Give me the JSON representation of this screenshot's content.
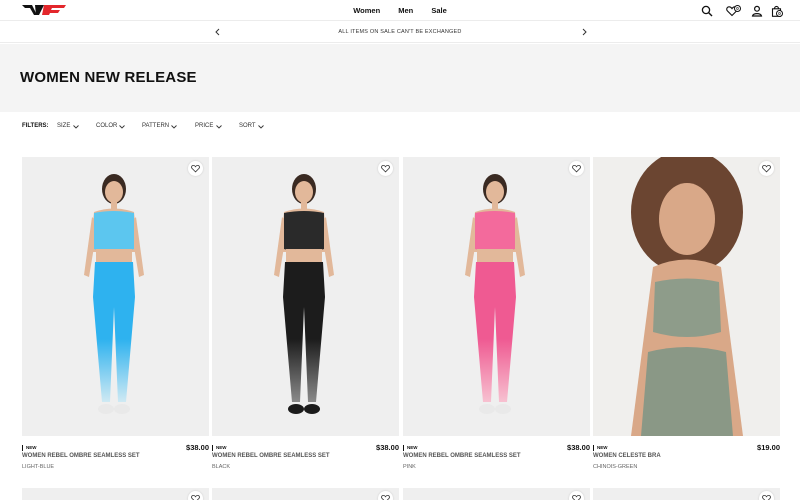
{
  "header": {
    "logo_alt": "VF",
    "nav": [
      "Women",
      "Men",
      "Sale"
    ],
    "icons": [
      "search-icon",
      "heart-icon",
      "user-icon",
      "bag-icon"
    ],
    "wishlist_count": "0",
    "cart_count": "0"
  },
  "announcement": {
    "text": "ALL ITEMS ON SALE CAN'T BE EXCHANGED"
  },
  "hero": {
    "title": "WOMEN NEW RELEASE"
  },
  "filters": {
    "label": "FILTERS:",
    "items": [
      "SIZE",
      "COLOR",
      "PATTERN",
      "PRICE",
      "SORT"
    ]
  },
  "products": [
    {
      "tag": "NEW",
      "name": "WOMEN REBEL OMBRE SEAMLESS SET",
      "price": "$38.00",
      "color": "LIGHT-BLUE",
      "top_color": "#5cc6ef",
      "bottom_color": "#2eb2ef",
      "fade_color": "#cfe9f3"
    },
    {
      "tag": "NEW",
      "name": "WOMEN REBEL OMBRE SEAMLESS SET",
      "price": "$38.00",
      "color": "BLACK",
      "top_color": "#2a2a2a",
      "bottom_color": "#1c1c1c",
      "fade_color": "#8a8a8a"
    },
    {
      "tag": "NEW",
      "name": "WOMEN REBEL OMBRE SEAMLESS SET",
      "price": "$38.00",
      "color": "PINK",
      "top_color": "#f36a9c",
      "bottom_color": "#ef5a92",
      "fade_color": "#f7c1d0"
    },
    {
      "tag": "NEW",
      "name": "WOMEN CELESTE BRA",
      "price": "$19.00",
      "color": "CHINOIS-GREEN",
      "top_color": "#8e9c8a",
      "bottom_color": "#8a9886",
      "fade_color": "#8a9886"
    }
  ],
  "colors": {
    "brand_red": "#e3262b",
    "text_dark": "#111111",
    "hero_bg": "#f4f4f4"
  }
}
